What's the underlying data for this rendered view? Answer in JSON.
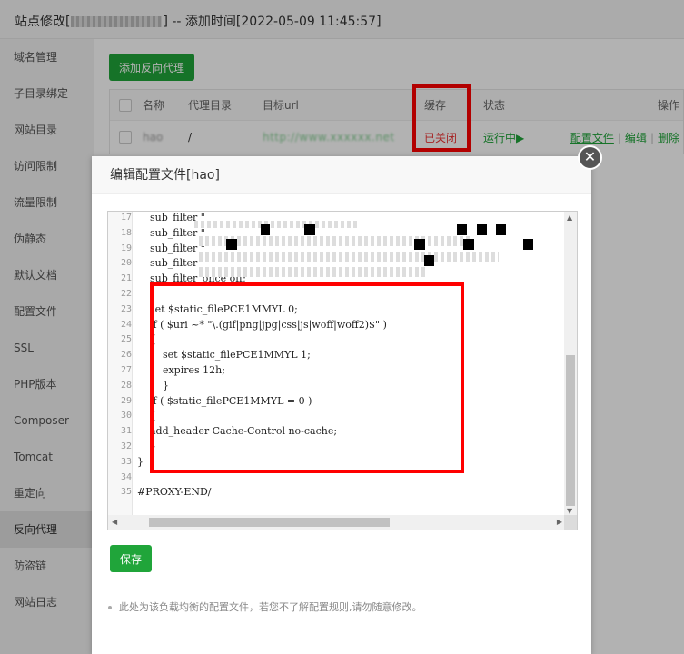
{
  "title": {
    "prefix": "站点修改[",
    "suffix": "] -- 添加时间[2022-05-09 11:45:57]"
  },
  "sidebar": {
    "items": [
      {
        "label": "域名管理"
      },
      {
        "label": "子目录绑定"
      },
      {
        "label": "网站目录"
      },
      {
        "label": "访问限制"
      },
      {
        "label": "流量限制"
      },
      {
        "label": "伪静态"
      },
      {
        "label": "默认文档"
      },
      {
        "label": "配置文件"
      },
      {
        "label": "SSL"
      },
      {
        "label": "PHP版本"
      },
      {
        "label": "Composer"
      },
      {
        "label": "Tomcat"
      },
      {
        "label": "重定向"
      },
      {
        "label": "反向代理"
      },
      {
        "label": "防盗链"
      },
      {
        "label": "网站日志"
      }
    ],
    "active": "反向代理"
  },
  "main": {
    "add_button": "添加反向代理",
    "table": {
      "headers": [
        "名称",
        "代理目录",
        "目标url",
        "缓存",
        "状态",
        "操作"
      ],
      "rows": [
        {
          "name": "hao",
          "dir": "/",
          "url": "http://www.xxxxxx.net",
          "cache": "已关闭",
          "status": "运行中▶",
          "ops": [
            "配置文件",
            "编辑",
            "删除"
          ]
        }
      ]
    }
  },
  "modal": {
    "title": "编辑配置文件[hao]",
    "save_button": "保存",
    "note": "此处为该负载均衡的配置文件，若您不了解配置规则,请勿随意修改。",
    "close_icon": "close-icon",
    "code_lines": [
      {
        "n": "17",
        "text": "    sub_filter \""
      },
      {
        "n": "18",
        "text": "    sub_filter \""
      },
      {
        "n": "19",
        "text": "    sub_filter \""
      },
      {
        "n": "20",
        "text": "    sub_filter \""
      },
      {
        "n": "21",
        "text": "    sub_filter_once off;"
      },
      {
        "n": "22",
        "text": ""
      },
      {
        "n": "23",
        "text": "    set $static_filePCE1MMYL 0;"
      },
      {
        "n": "24",
        "text": "    if ( $uri ~* \"\\.(gif|png|jpg|css|js|woff|woff2)$\" )"
      },
      {
        "n": "25",
        "text": "    {"
      },
      {
        "n": "26",
        "text": "        set $static_filePCE1MMYL 1;"
      },
      {
        "n": "27",
        "text": "        expires 12h;"
      },
      {
        "n": "28",
        "text": "        }"
      },
      {
        "n": "29",
        "text": "    if ( $static_filePCE1MMYL = 0 )"
      },
      {
        "n": "30",
        "text": "    {"
      },
      {
        "n": "31",
        "text": "    add_header Cache-Control no-cache;"
      },
      {
        "n": "32",
        "text": "    }"
      },
      {
        "n": "33",
        "text": "}"
      },
      {
        "n": "34",
        "text": ""
      },
      {
        "n": "35",
        "text": "#PROXY-END/"
      }
    ]
  },
  "colors": {
    "accent": "#20a53a",
    "danger": "#e33",
    "highlight": "#ff0000"
  }
}
